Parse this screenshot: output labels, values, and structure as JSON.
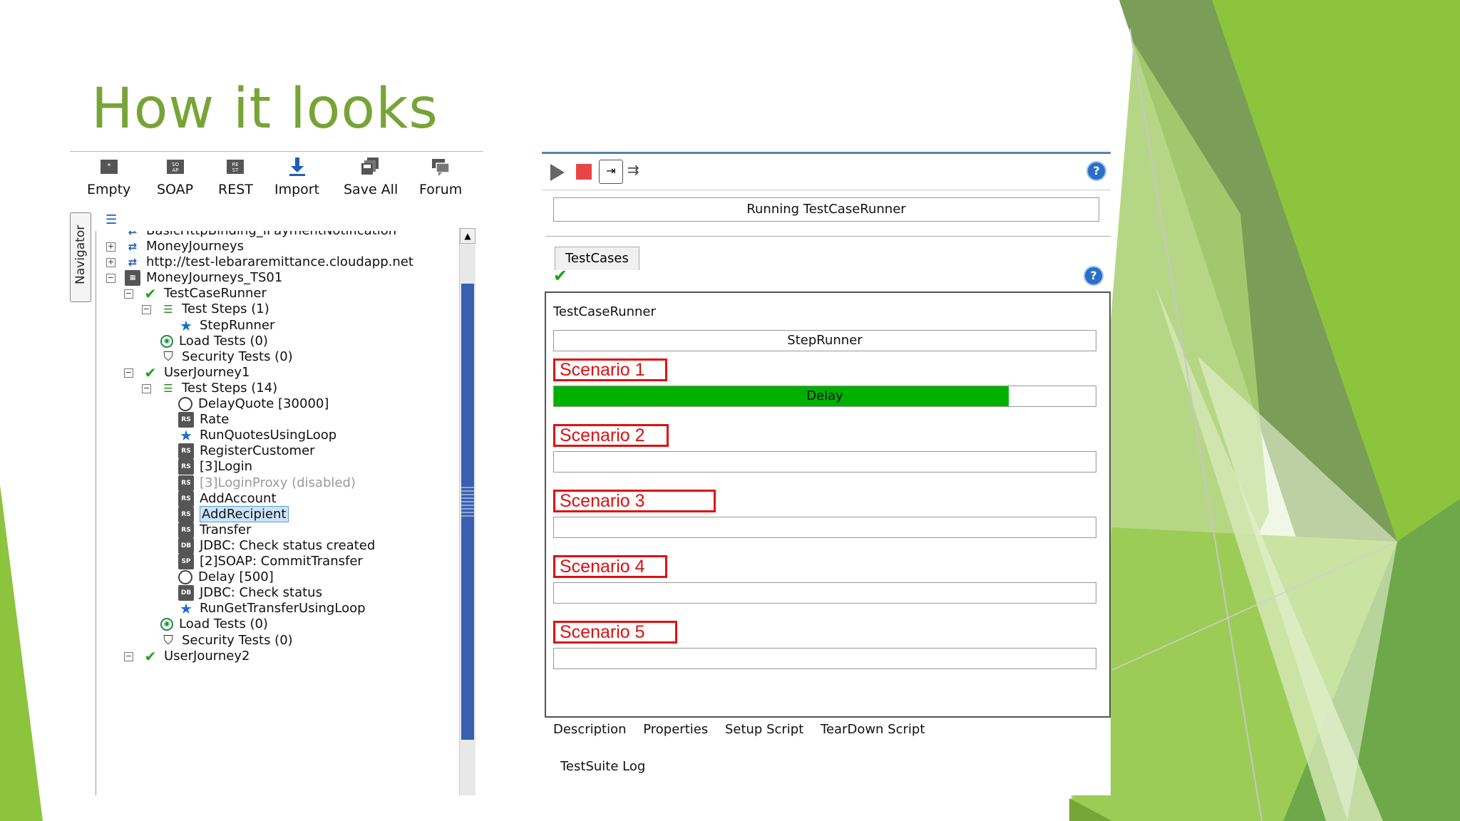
{
  "slide": {
    "title": "How it looks"
  },
  "toolbar": {
    "buttons": [
      {
        "label": "Empty",
        "icon": "empty-project-icon"
      },
      {
        "label": "SOAP",
        "icon": "soap-icon"
      },
      {
        "label": "REST",
        "icon": "rest-icon"
      },
      {
        "label": "Import",
        "icon": "import-icon"
      },
      {
        "label": "Save All",
        "icon": "save-all-icon"
      },
      {
        "label": "Forum",
        "icon": "forum-icon"
      }
    ]
  },
  "navigator": {
    "label": "Navigator"
  },
  "tree": {
    "items": [
      {
        "label": "BasicHttpBinding_IPaymentNotification",
        "icon": "interface-icon"
      },
      {
        "label": "MoneyJourneys",
        "icon": "interface-icon"
      },
      {
        "label": "http://test-lebararemittance.cloudapp.net",
        "icon": "interface-icon"
      },
      {
        "label": "MoneyJourneys_TS01",
        "icon": "testsuite-icon"
      },
      {
        "label": "TestCaseRunner",
        "icon": "check-icon"
      },
      {
        "label": "Test Steps (1)",
        "icon": "steps-icon"
      },
      {
        "label": "StepRunner",
        "icon": "star-icon"
      },
      {
        "label": "Load Tests (0)",
        "icon": "load-icon"
      },
      {
        "label": "Security Tests (0)",
        "icon": "shield-icon"
      },
      {
        "label": "UserJourney1",
        "icon": "check-icon"
      },
      {
        "label": "Test Steps (14)",
        "icon": "steps-icon"
      },
      {
        "label": "DelayQuote [30000]",
        "icon": "clock-icon"
      },
      {
        "label": "Rate",
        "icon": "rest-step-icon"
      },
      {
        "label": "RunQuotesUsingLoop",
        "icon": "star-icon"
      },
      {
        "label": "RegisterCustomer",
        "icon": "rest-step-icon"
      },
      {
        "label": "[3]Login",
        "icon": "rest-step-icon"
      },
      {
        "label": "[3]LoginProxy (disabled)",
        "icon": "rest-step-icon"
      },
      {
        "label": "AddAccount",
        "icon": "rest-step-icon"
      },
      {
        "label": "AddRecipient",
        "icon": "rest-step-icon"
      },
      {
        "label": "Transfer",
        "icon": "rest-step-icon"
      },
      {
        "label": "JDBC: Check status created",
        "icon": "jdbc-step-icon"
      },
      {
        "label": "[2]SOAP: CommitTransfer",
        "icon": "soap-step-icon"
      },
      {
        "label": "Delay [500]",
        "icon": "clock-icon"
      },
      {
        "label": "JDBC: Check status",
        "icon": "jdbc-step-icon"
      },
      {
        "label": "RunGetTransferUsingLoop",
        "icon": "star-icon"
      },
      {
        "label": "Load Tests (0)",
        "icon": "load-icon"
      },
      {
        "label": "Security Tests (0)",
        "icon": "shield-icon"
      },
      {
        "label": "UserJourney2",
        "icon": "check-icon"
      }
    ]
  },
  "runner": {
    "status": "Running TestCaseRunner",
    "tab": "TestCases",
    "testcase_label": "TestCaseRunner",
    "step_bar": "StepRunner",
    "scenarios": [
      {
        "label": "Scenario 1",
        "bar_text": "Delay",
        "progress": 0.84
      },
      {
        "label": "Scenario 2",
        "bar_text": "",
        "progress": 0
      },
      {
        "label": "Scenario 3",
        "bar_text": "",
        "progress": 0
      },
      {
        "label": "Scenario 4",
        "bar_text": "",
        "progress": 0
      },
      {
        "label": "Scenario 5",
        "bar_text": "",
        "progress": 0
      }
    ],
    "bottom_tabs": [
      "Description",
      "Properties",
      "Setup Script",
      "TearDown Script"
    ],
    "log_label": "TestSuite Log"
  },
  "colors": {
    "title_green": "#77a436",
    "progress_green": "#00b000",
    "scenario_red": "#e01010"
  }
}
